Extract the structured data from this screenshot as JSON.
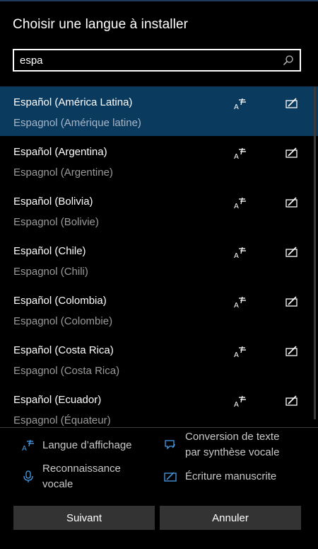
{
  "dialog": {
    "title": "Choisir une langue à installer"
  },
  "search": {
    "value": "espa",
    "icon": "search-icon"
  },
  "languages": [
    {
      "name": "Español (América Latina)",
      "native": "Espagnol (Amérique latine)",
      "selected": true
    },
    {
      "name": "Español (Argentina)",
      "native": "Espagnol (Argentine)",
      "selected": false
    },
    {
      "name": "Español (Bolivia)",
      "native": "Espagnol (Bolivie)",
      "selected": false
    },
    {
      "name": "Español (Chile)",
      "native": "Espagnol (Chili)",
      "selected": false
    },
    {
      "name": "Español (Colombia)",
      "native": "Espagnol (Colombie)",
      "selected": false
    },
    {
      "name": "Español (Costa Rica)",
      "native": "Espagnol (Costa Rica)",
      "selected": false
    },
    {
      "name": "Español (Ecuador)",
      "native": "Espagnol (Équateur)",
      "selected": false
    }
  ],
  "legend": {
    "display_language": "Langue d’affichage",
    "tts_line1": "Conversion de texte",
    "tts_line2": "par synthèse vocale",
    "speech_line1": "Reconnaissance",
    "speech_line2": "vocale",
    "handwriting": "Écriture manuscrite"
  },
  "buttons": {
    "next": "Suivant",
    "cancel": "Annuler"
  },
  "colors": {
    "accent": "#4a9ee8",
    "selected_row": "#0b3a5f",
    "button_bg": "#333333"
  }
}
